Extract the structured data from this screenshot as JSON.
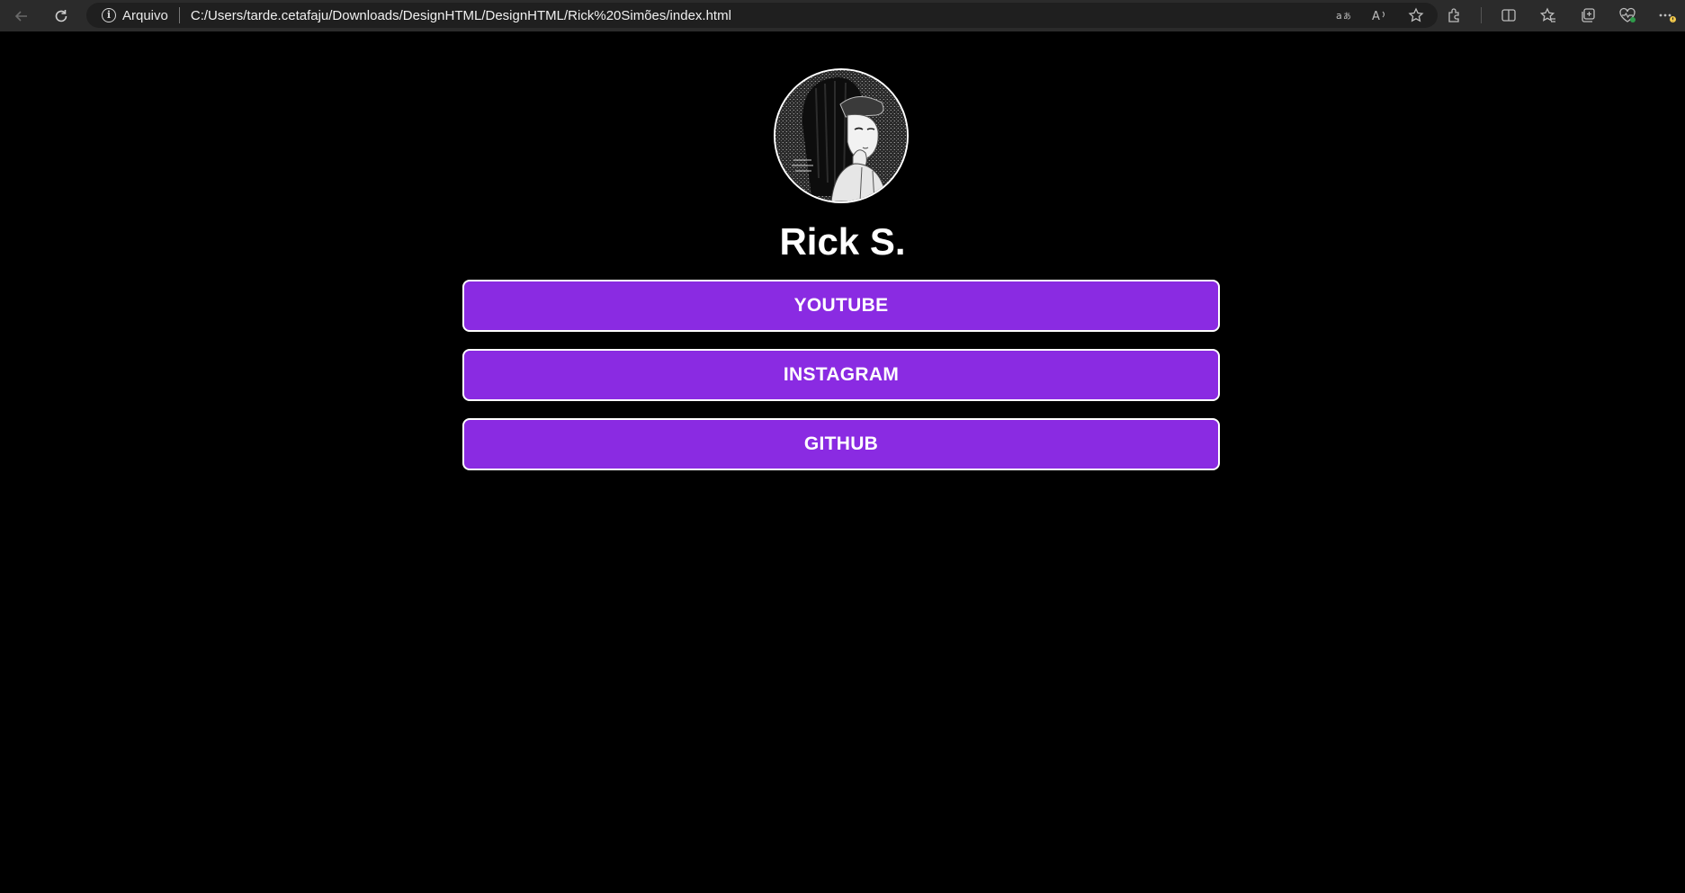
{
  "browser": {
    "site_info_label": "Arquivo",
    "url": "C:/Users/tarde.cetafaju/Downloads/DesignHTML/DesignHTML/Rick%20Simões/index.html",
    "info_icon_glyph": "i"
  },
  "profile": {
    "name": "Rick S.",
    "accent_color": "#8a2be2"
  },
  "links": [
    {
      "label": "YOUTUBE"
    },
    {
      "label": "INSTAGRAM"
    },
    {
      "label": "GITHUB"
    }
  ],
  "icons": [
    "back-icon",
    "refresh-icon",
    "info-icon",
    "translate-icon",
    "read-aloud-icon",
    "favorite-star-icon",
    "extensions-icon",
    "split-screen-icon",
    "favorites-icon",
    "collections-icon",
    "health-icon",
    "more-icon"
  ]
}
